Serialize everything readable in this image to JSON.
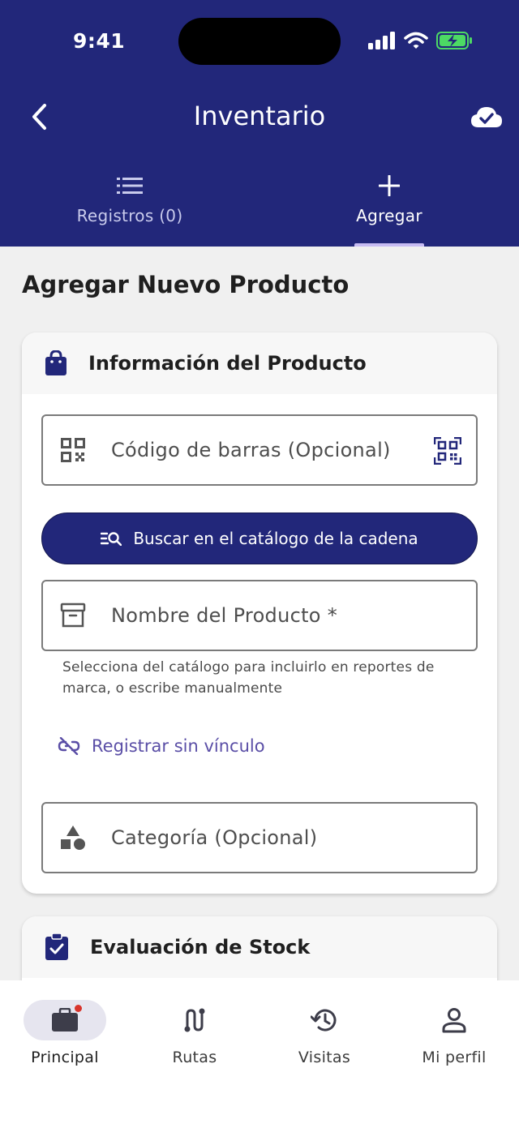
{
  "status_bar": {
    "time": "9:41"
  },
  "header": {
    "title": "Inventario"
  },
  "tabs": [
    {
      "label": "Registros (0)",
      "icon": "list-icon",
      "active": false
    },
    {
      "label": "Agregar",
      "icon": "plus-icon",
      "active": true
    }
  ],
  "page": {
    "title": "Agregar Nuevo Producto"
  },
  "product_card": {
    "title": "Información del Producto",
    "barcode_placeholder": "Código de barras (Opcional)",
    "search_button_label": "Buscar en el catálogo de la cadena",
    "name_placeholder": "Nombre del Producto *",
    "helper_text": "Selecciona del catálogo para incluirlo en reportes de marca, o escribe manualmente",
    "unlink_label": "Registrar sin vínculo",
    "category_placeholder": "Categoría (Opcional)"
  },
  "stock_card": {
    "title": "Evaluación de Stock"
  },
  "bottom_nav": [
    {
      "label": "Principal",
      "icon": "briefcase-icon",
      "active": true
    },
    {
      "label": "Rutas",
      "icon": "route-icon",
      "active": false
    },
    {
      "label": "Visitas",
      "icon": "history-icon",
      "active": false
    },
    {
      "label": "Mi perfil",
      "icon": "person-icon",
      "active": false
    }
  ],
  "colors": {
    "primary": "#22277a",
    "accent_link": "#5a4ea6",
    "battery": "#4cd964",
    "badge": "#d8342b"
  }
}
